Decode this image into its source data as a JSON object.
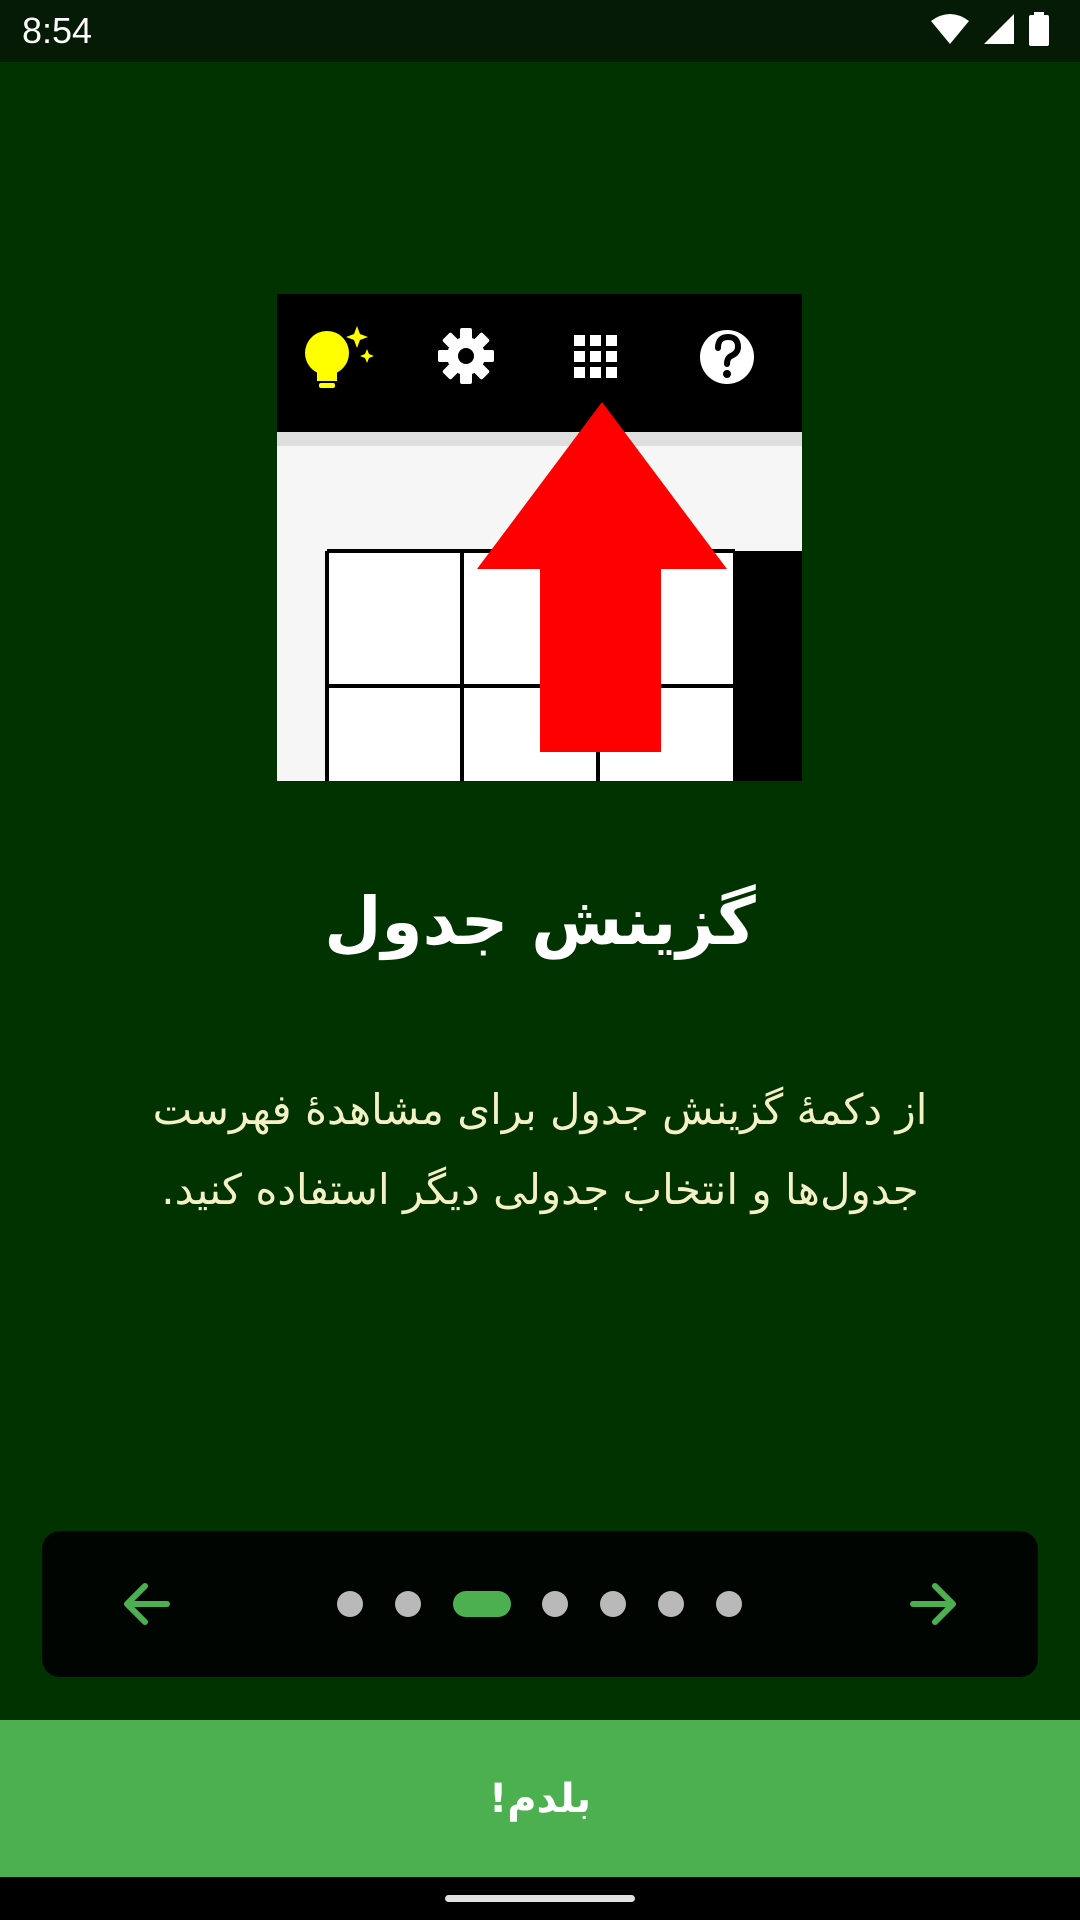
{
  "status_bar": {
    "time": "8:54",
    "icons": [
      "wifi-icon",
      "signal-icon",
      "battery-icon"
    ]
  },
  "illustration": {
    "toolbar_icons": [
      "lightbulb-icon",
      "gear-icon",
      "grid-icon",
      "help-icon"
    ],
    "arrow_color": "#ff0000",
    "bulb_color": "#ffff00"
  },
  "onboarding": {
    "title": "گزینش جدول",
    "description_line1": "از دکمهٔ گزینش جدول برای مشاهدهٔ فهرست",
    "description_line2": "جدول‌ها و انتخاب جدولی دیگر استفاده کنید."
  },
  "pager": {
    "prev_icon": "arrow-left-icon",
    "next_icon": "arrow-right-icon",
    "page_count": 7,
    "current_page": 3,
    "accent_color": "#4caf50"
  },
  "actions": {
    "got_it_label": "بلدم!"
  },
  "colors": {
    "background": "#003300",
    "button": "#4caf50",
    "title_text": "#ffffff",
    "body_text": "#f4f1c4"
  }
}
